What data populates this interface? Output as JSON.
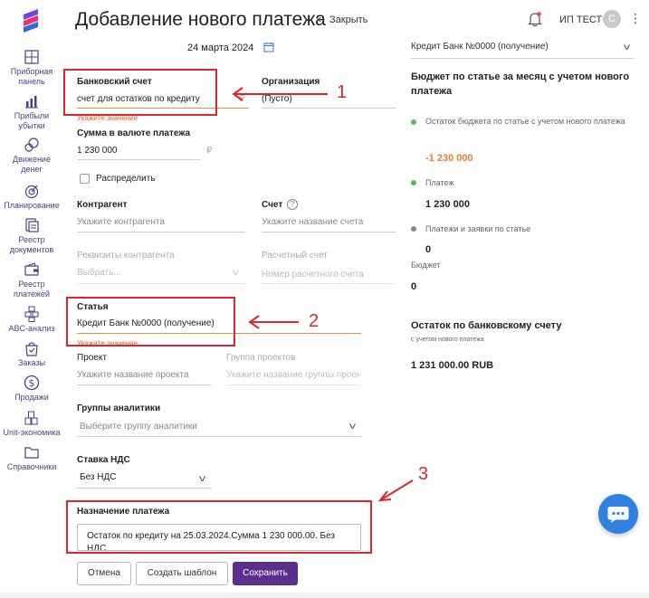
{
  "header": {
    "title": "Добавление нового платежа",
    "close_label": "Закрыть",
    "user_name": "ИП ТЕСТ",
    "avatar_letter": "С"
  },
  "sidebar": {
    "items": [
      {
        "label_line1": "Приборная",
        "label_line2": "панель",
        "icon": "dashboard-icon"
      },
      {
        "label_line1": "Прибыли",
        "label_line2": "убытки",
        "icon": "bar-chart-icon"
      },
      {
        "label_line1": "Движение",
        "label_line2": "денег",
        "icon": "money-flow-icon"
      },
      {
        "label_line1": "Планирование",
        "label_line2": "",
        "icon": "target-icon"
      },
      {
        "label_line1": "Реестр",
        "label_line2": "документов",
        "icon": "documents-icon"
      },
      {
        "label_line1": "Реестр",
        "label_line2": "платежей",
        "icon": "wallet-icon"
      },
      {
        "label_line1": "ABC-анализ",
        "label_line2": "",
        "icon": "abc-icon"
      },
      {
        "label_line1": "Заказы",
        "label_line2": "",
        "icon": "orders-icon"
      },
      {
        "label_line1": "Продажи",
        "label_line2": "",
        "icon": "sales-icon"
      },
      {
        "label_line1": "Unit-экономика",
        "label_line2": "",
        "icon": "unit-economics-icon"
      },
      {
        "label_line1": "Справочники",
        "label_line2": "",
        "icon": "folder-icon"
      }
    ]
  },
  "form": {
    "date": "24 марта 2024",
    "bank_account": {
      "label": "Банковский счет",
      "value": "счет для остатков по кредиту",
      "error": "Укажите значение",
      "currency": "₽"
    },
    "organization": {
      "label": "Организация",
      "value": "(Пусто)"
    },
    "amount": {
      "label": "Сумма в валюте платежа",
      "value": "1 230 000",
      "currency": "₽"
    },
    "distribute": {
      "label": "Распределить",
      "checked": false
    },
    "counterparty": {
      "label": "Контрагент",
      "placeholder": "Укажите контрагента"
    },
    "invoice": {
      "label": "Счет",
      "placeholder": "Укажите название счета"
    },
    "counterparty_details": {
      "label": "Реквизиты контрагента",
      "placeholder": "Выбрать..."
    },
    "settlement_account": {
      "label": "Расчетный счет",
      "placeholder": "Номер расчетного счета"
    },
    "article": {
      "label": "Статья",
      "value": "Кредит Банк №0000 (получение)",
      "error": "Укажите значение"
    },
    "project": {
      "label": "Проект",
      "placeholder": "Укажите название проекта"
    },
    "project_group": {
      "label": "Группа проектов",
      "placeholder": "Укажите название группы проен"
    },
    "analytics_groups": {
      "label": "Группы аналитики",
      "placeholder": "Выберите группу аналитики"
    },
    "vat_rate": {
      "label": "Ставка НДС",
      "value": "Без НДС"
    },
    "purpose": {
      "label": "Назначение платежа",
      "value_line1": "Остаток по кредиту на 25.03.2024.Сумма 1 230 000.00. Без",
      "value_line2": "НДС"
    }
  },
  "buttons": {
    "cancel": "Отмена",
    "create_template": "Создать шаблон",
    "save": "Сохранить"
  },
  "right_panel": {
    "select_value": "Кредит Банк №0000 (получение)",
    "heading": "Бюджет по статье за месяц с учетом нового платежа",
    "budget_remaining": {
      "label": "Остаток бюджета по статье с учетом нового платежа",
      "value": "-1 230 000",
      "color": "#5cb85c"
    },
    "payment": {
      "label": "Платеж",
      "value": "1 230 000",
      "color": "#5cb85c"
    },
    "payments_requests": {
      "label": "Платежи и заявки по статье",
      "value": "0",
      "color": "#888888"
    },
    "budget": {
      "label": "Бюджет",
      "value": "0"
    },
    "bank_balance": {
      "heading": "Остаток по банковскому счету",
      "subtitle": "с учетом нового платежа",
      "value": "1 231 000.00 RUB"
    }
  },
  "annotations": {
    "n1": "1",
    "n2": "2",
    "n3": "3"
  },
  "colors": {
    "accent": "#5c2f8f",
    "annotation_red": "#e0242c",
    "error_orange": "#e45a2d",
    "fab_blue": "#2f80e0"
  }
}
